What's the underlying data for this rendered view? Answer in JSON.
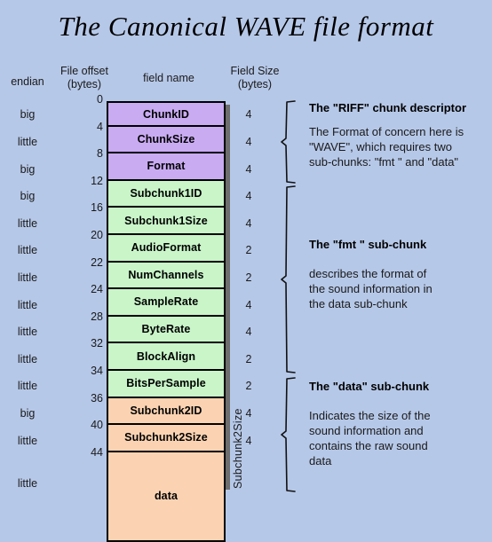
{
  "title": "The Canonical WAVE file format",
  "colors": {
    "background": "#b6c8e8",
    "riff_chunk": "#c9abf2",
    "fmt_chunk": "#c9f5c9",
    "data_chunk": "#fbd3b2",
    "shadow": "#6e6e6e",
    "text": "#000000"
  },
  "headers": {
    "endian": "endian",
    "file_offset_line1": "File offset",
    "file_offset_line2": "(bytes)",
    "field_name": "field name",
    "field_size_line1": "Field Size",
    "field_size_line2": "(bytes)"
  },
  "rows": [
    {
      "endian": "big",
      "offset": "0",
      "field": "ChunkID",
      "size": "4",
      "group": "riff"
    },
    {
      "endian": "little",
      "offset": "4",
      "field": "ChunkSize",
      "size": "4",
      "group": "riff"
    },
    {
      "endian": "big",
      "offset": "8",
      "field": "Format",
      "size": "4",
      "group": "riff"
    },
    {
      "endian": "big",
      "offset": "12",
      "field": "Subchunk1ID",
      "size": "4",
      "group": "fmt"
    },
    {
      "endian": "little",
      "offset": "16",
      "field": "Subchunk1Size",
      "size": "4",
      "group": "fmt"
    },
    {
      "endian": "little",
      "offset": "20",
      "field": "AudioFormat",
      "size": "2",
      "group": "fmt"
    },
    {
      "endian": "little",
      "offset": "22",
      "field": "NumChannels",
      "size": "2",
      "group": "fmt"
    },
    {
      "endian": "little",
      "offset": "24",
      "field": "SampleRate",
      "size": "4",
      "group": "fmt"
    },
    {
      "endian": "little",
      "offset": "28",
      "field": "ByteRate",
      "size": "4",
      "group": "fmt"
    },
    {
      "endian": "little",
      "offset": "32",
      "field": "BlockAlign",
      "size": "2",
      "group": "fmt"
    },
    {
      "endian": "little",
      "offset": "34",
      "field": "BitsPerSample",
      "size": "2",
      "group": "fmt"
    },
    {
      "endian": "big",
      "offset": "36",
      "field": "Subchunk2ID",
      "size": "4",
      "group": "data"
    },
    {
      "endian": "little",
      "offset": "40",
      "field": "Subchunk2Size",
      "size": "4",
      "group": "data"
    },
    {
      "endian": "little",
      "offset": "44",
      "field": "data",
      "size": "",
      "group": "data"
    }
  ],
  "data_size_label": "Subchunk2Size",
  "notes": [
    {
      "title": "The \"RIFF\" chunk descriptor",
      "lines": [
        "The Format of concern here is",
        "\"WAVE\", which requires two",
        "sub-chunks: \"fmt \" and \"data\""
      ]
    },
    {
      "title": "The \"fmt \" sub-chunk",
      "lines": [
        "describes the format of",
        "the sound information in",
        "the data sub-chunk"
      ]
    },
    {
      "title": "The \"data\" sub-chunk",
      "lines": [
        "Indicates the size of the",
        "sound information and",
        "contains the raw sound",
        "data"
      ]
    }
  ]
}
